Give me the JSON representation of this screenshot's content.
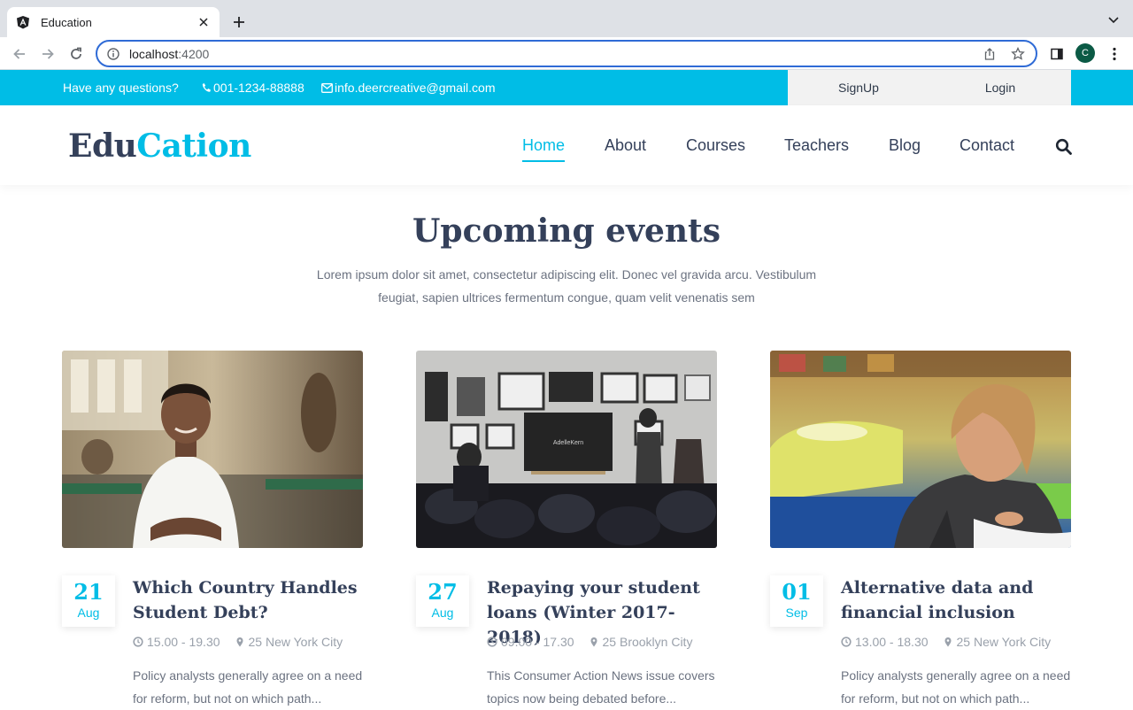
{
  "browser": {
    "tab_title": "Education",
    "url_host": "localhost",
    "url_port": ":4200",
    "profile_initial": "C"
  },
  "topbar": {
    "question": "Have any questions?",
    "phone": "001-1234-88888",
    "email": "info.deercreative@gmail.com",
    "signup": "SignUp",
    "login": "Login",
    "accent_color": "#00bde6"
  },
  "header": {
    "logo_part1": "Edu",
    "logo_part2": "Cation",
    "nav": [
      "Home",
      "About",
      "Courses",
      "Teachers",
      "Blog",
      "Contact"
    ],
    "active_nav": "Home"
  },
  "section": {
    "title": "Upcoming events",
    "description": "Lorem ipsum dolor sit amet, consectetur adipiscing elit. Donec vel gravida arcu. Vestibulum feugiat, sapien ultrices fermentum congue, quam velit venenatis sem"
  },
  "events": [
    {
      "day": "21",
      "month": "Aug",
      "title": "Which Country Handles Student Debt?",
      "time": "15.00 - 19.30",
      "location": "25 New York City",
      "excerpt": "Policy analysts generally agree on a need for reform, but not on which path..."
    },
    {
      "day": "27",
      "month": "Aug",
      "title": "Repaying your student loans (Winter 2017-2018)",
      "time": "09.00 - 17.30",
      "location": "25 Brooklyn City",
      "excerpt": "This Consumer Action News issue covers topics now being debated before...",
      "screen_text": "AdelleKern"
    },
    {
      "day": "01",
      "month": "Sep",
      "title": "Alternative data and financial inclusion",
      "time": "13.00 - 18.30",
      "location": "25 New York City",
      "excerpt": "Policy analysts generally agree on a need for reform, but not on which path..."
    }
  ]
}
